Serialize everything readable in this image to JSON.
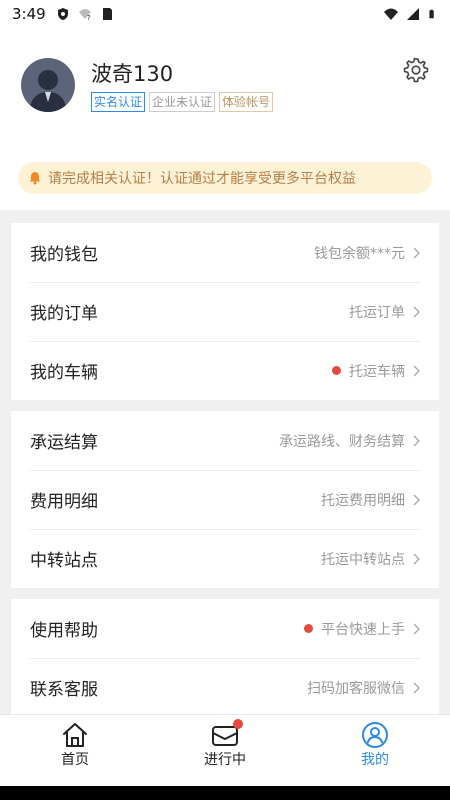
{
  "status_bar": {
    "time": "3:49",
    "left_icons": [
      "shield-icon",
      "wifi-question-icon",
      "sd-card-icon"
    ],
    "right_icons": [
      "wifi-icon",
      "signal-icon",
      "battery-icon"
    ]
  },
  "profile": {
    "username": "波奇130",
    "badges": [
      {
        "label": "实名认证",
        "style": "primary"
      },
      {
        "label": "企业未认证",
        "style": "muted"
      },
      {
        "label": "体验帐号",
        "style": "gold"
      }
    ],
    "settings_icon": "gear-icon"
  },
  "notice": {
    "text": "请完成相关认证！认证通过才能享受更多平台权益",
    "icon": "bell-icon"
  },
  "sections": [
    {
      "rows": [
        {
          "title": "我的钱包",
          "hint": "钱包余额***元",
          "dot": false
        },
        {
          "title": "我的订单",
          "hint": "托运订单",
          "dot": false
        },
        {
          "title": "我的车辆",
          "hint": "托运车辆",
          "dot": true
        }
      ]
    },
    {
      "rows": [
        {
          "title": "承运结算",
          "hint": "承运路线、财务结算",
          "dot": false
        },
        {
          "title": "费用明细",
          "hint": "托运费用明细",
          "dot": false
        },
        {
          "title": "中转站点",
          "hint": "托运中转站点",
          "dot": false
        }
      ]
    },
    {
      "rows": [
        {
          "title": "使用帮助",
          "hint": "平台快速上手",
          "dot": true
        },
        {
          "title": "联系客服",
          "hint": "扫码加客服微信",
          "dot": false
        }
      ]
    }
  ],
  "bottom_nav": [
    {
      "label": "首页",
      "icon": "home-icon",
      "active": false
    },
    {
      "label": "进行中",
      "icon": "mail-icon",
      "active": false,
      "badge_dot": true
    },
    {
      "label": "我的",
      "icon": "user-icon",
      "active": true
    }
  ],
  "colors": {
    "accent": "#2e8be8",
    "notice_bg": "#fdf1d6",
    "notice_text": "#b5804a",
    "dot": "#e54a3d"
  }
}
